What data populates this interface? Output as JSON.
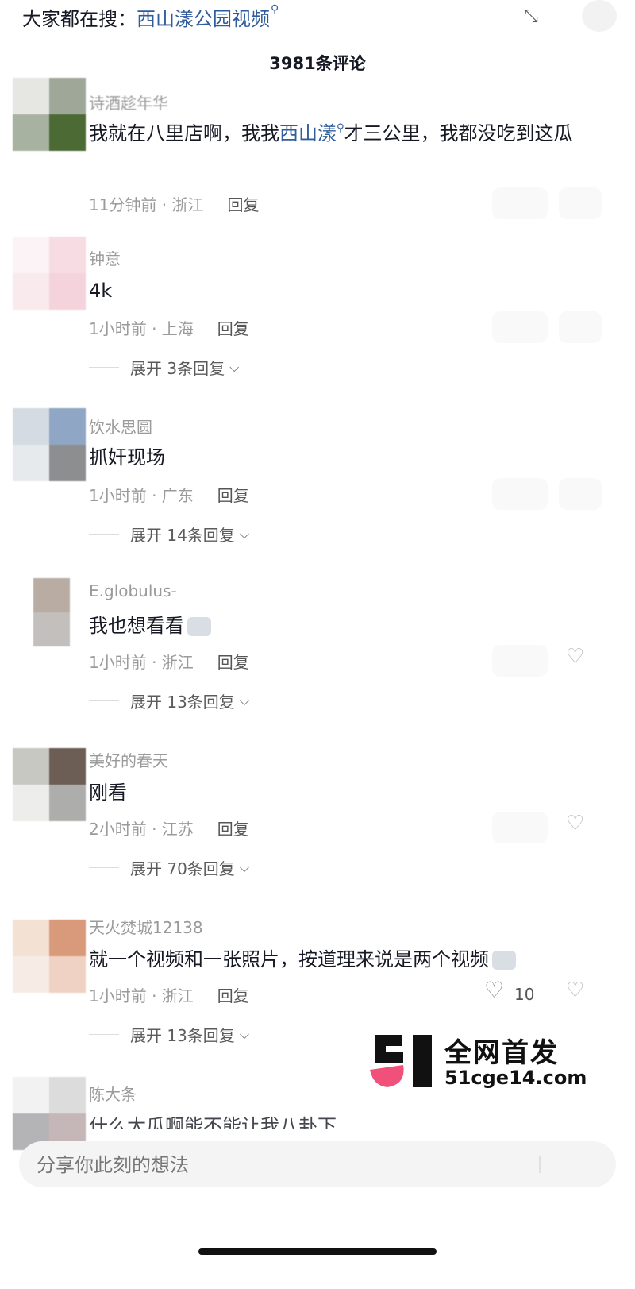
{
  "header": {
    "search_prefix": "大家都在搜：",
    "search_keyword": "西山漾公园视频",
    "comment_count_title": "3981条评论"
  },
  "comments": [
    {
      "nickname": "诗酒趁年华",
      "text_before": "我就在八里店啊，我我",
      "keyword": "西山漾",
      "text_after": "才三公里，我都没吃到这瓜",
      "time_location": "11分钟前 · 浙江",
      "reply_label": "回复",
      "avatar_colors": [
        "#e6e6e3",
        "#9fa898",
        "#a8b2a0",
        "#4c6a33"
      ]
    },
    {
      "nickname": "钟意",
      "text": "4k",
      "time_location": "1小时前 · 上海",
      "reply_label": "回复",
      "expand_label": "展开 3条回复",
      "avatar_colors": [
        "#fbf3f5",
        "#f7dce3",
        "#f9eaee",
        "#f5d3dc"
      ]
    },
    {
      "nickname": "饮水思圆",
      "text": "抓奸现场",
      "time_location": "1小时前 · 广东",
      "reply_label": "回复",
      "expand_label": "展开 14条回复",
      "avatar_colors": [
        "#d4dbe3",
        "#8fa6c4",
        "#e7eaed",
        "#8d8e8f"
      ]
    },
    {
      "nickname": "E.globulus-",
      "text": "我也想看看",
      "time_location": "1小时前 · 浙江",
      "reply_label": "回复",
      "expand_label": "展开 13条回复",
      "avatar_colors": [
        "#b8aca3",
        "#c2bfbc"
      ]
    },
    {
      "nickname": "美好的春天",
      "text": "刚看",
      "time_location": "2小时前 · 江苏",
      "reply_label": "回复",
      "expand_label": "展开 70条回复",
      "avatar_colors": [
        "#c8c8c2",
        "#6c5d55",
        "#ededeb",
        "#adadab"
      ]
    },
    {
      "nickname": "天火焚城12138",
      "text": "就一个视频和一张照片，按道理来说是两个视频",
      "time_location": "1小时前 · 浙江",
      "reply_label": "回复",
      "like_count": "10",
      "expand_label": "展开 13条回复",
      "avatar_colors": [
        "#f3e1d3",
        "#d89a7b",
        "#f7ece5",
        "#f0d2c4"
      ]
    },
    {
      "nickname": "陈大条",
      "text": "什么大瓜啊能不能让我八卦下",
      "avatar_colors": [
        "#f2f2f2",
        "#dcdcdc",
        "#b4b4b6",
        "#c5b7b8"
      ]
    }
  ],
  "watermark": {
    "line1": "全网首发",
    "line2": "51cge14.com",
    "logo_colors": {
      "dark": "#111111",
      "pink": "#f0507a"
    }
  },
  "input": {
    "placeholder": "分享你此刻的想法"
  },
  "icons": {
    "search_keyword_icon": "magnifier-icon",
    "collapse": "collapse-arrows-icon",
    "like": "heart-icon",
    "dislike": "broken-heart-icon",
    "expand": "chevron-down-icon"
  }
}
